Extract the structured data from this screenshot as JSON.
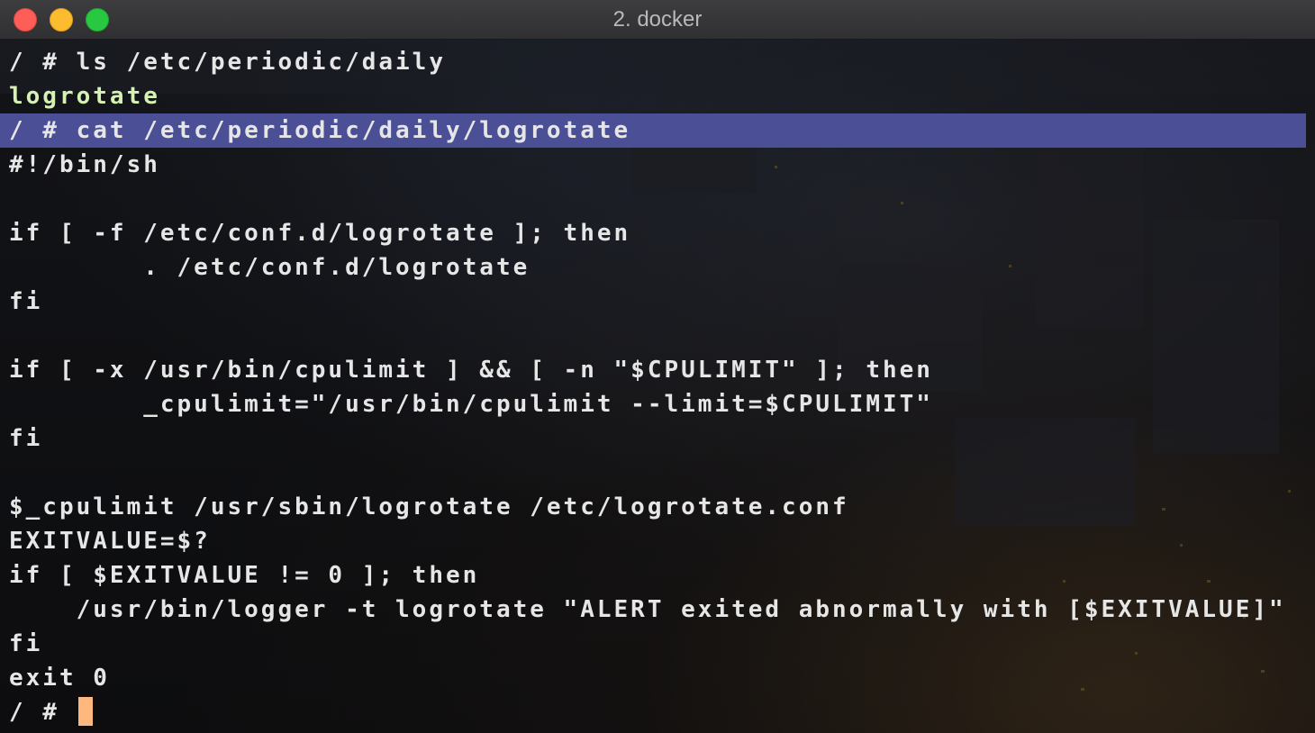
{
  "window": {
    "title": "2. docker"
  },
  "colors": {
    "highlight": "#4a4f96",
    "directory_listing": "#d7f0b4",
    "cursor": "#fdb77f",
    "text": "#e6e6e6"
  },
  "terminal": {
    "lines": [
      "/ # ls /etc/periodic/daily",
      "logrotate",
      "/ # cat /etc/periodic/daily/logrotate",
      "#!/bin/sh",
      "",
      "if [ -f /etc/conf.d/logrotate ]; then",
      "        . /etc/conf.d/logrotate",
      "fi",
      "",
      "if [ -x /usr/bin/cpulimit ] && [ -n \"$CPULIMIT\" ]; then",
      "        _cpulimit=\"/usr/bin/cpulimit --limit=$CPULIMIT\"",
      "fi",
      "",
      "$_cpulimit /usr/sbin/logrotate /etc/logrotate.conf",
      "EXITVALUE=$?",
      "if [ $EXITVALUE != 0 ]; then",
      "    /usr/bin/logger -t logrotate \"ALERT exited abnormally with [$EXITVALUE]\"",
      "fi",
      "exit 0"
    ],
    "prompt": "/ # "
  }
}
